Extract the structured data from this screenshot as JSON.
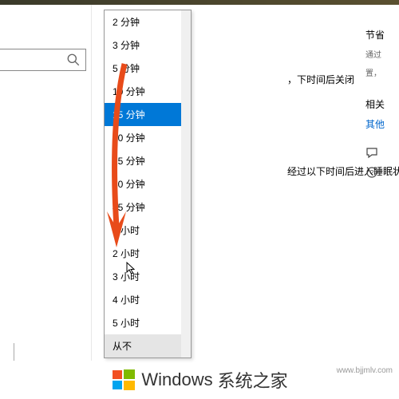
{
  "dropdown": {
    "items": [
      {
        "label": "2 分钟"
      },
      {
        "label": "3 分钟"
      },
      {
        "label": "5 分钟"
      },
      {
        "label": "10 分钟"
      },
      {
        "label": "15 分钟",
        "selected": true
      },
      {
        "label": "20 分钟"
      },
      {
        "label": "25 分钟"
      },
      {
        "label": "30 分钟"
      },
      {
        "label": "45 分钟"
      },
      {
        "label": "1 小时"
      },
      {
        "label": "2 小时"
      },
      {
        "label": "3 小时"
      },
      {
        "label": "4 小时"
      },
      {
        "label": "5 小时"
      },
      {
        "label": "从不",
        "hover": true
      }
    ]
  },
  "main": {
    "screen_off_text": "，下时间后关闭",
    "sleep_text": "经过以下时间后进入睡眠状态"
  },
  "right": {
    "heading1": "节省",
    "sub1": "通过",
    "sub2": "置，",
    "heading2": "相关",
    "link": "其他"
  },
  "footer": {
    "brand": "Windows",
    "suffix": "系统之家",
    "url": "www.bjjmlv.com"
  },
  "search": {
    "placeholder": ""
  }
}
